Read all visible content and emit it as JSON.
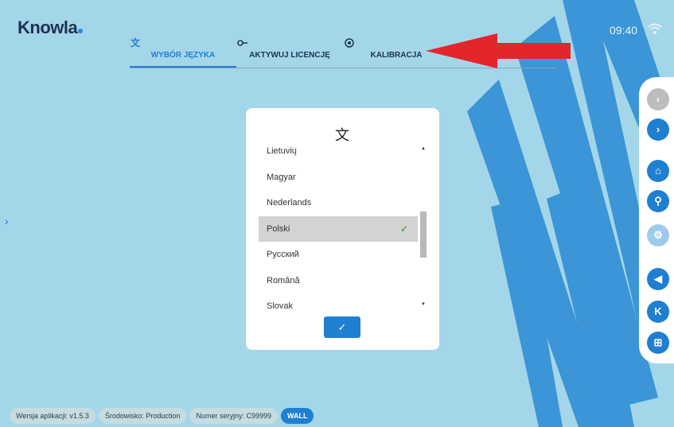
{
  "app": {
    "logo": "Knowla",
    "clock": "09:40"
  },
  "tabs": [
    {
      "label": "WYBÓR JĘZYKA",
      "icon": "translate-icon",
      "active": true
    },
    {
      "label": "AKTYWUJ LICENCJĘ",
      "icon": "key-icon",
      "active": false
    },
    {
      "label": "KALIBRACJA",
      "icon": "target-icon",
      "active": false
    }
  ],
  "dialog": {
    "languages": [
      "Lietuvių",
      "Magyar",
      "Nederlands",
      "Polski",
      "Русский",
      "Română",
      "Slovak"
    ],
    "selected": "Polski",
    "confirm_label": "✓"
  },
  "sidebar": [
    "back-icon",
    "forward-icon",
    "home-icon",
    "search-icon",
    "gear-icon",
    "volume-icon",
    "knowla-k-icon",
    "windows-icon"
  ],
  "footer": {
    "version": "Wersja aplikacji: v1.5.3",
    "environment": "Środowisko: Production",
    "serial": "Numer seryjny: C99999",
    "mode": "WALL"
  },
  "colors": {
    "background": "#a4d6e9",
    "accent": "#1f7fd1",
    "arrow": "#e2262b"
  }
}
